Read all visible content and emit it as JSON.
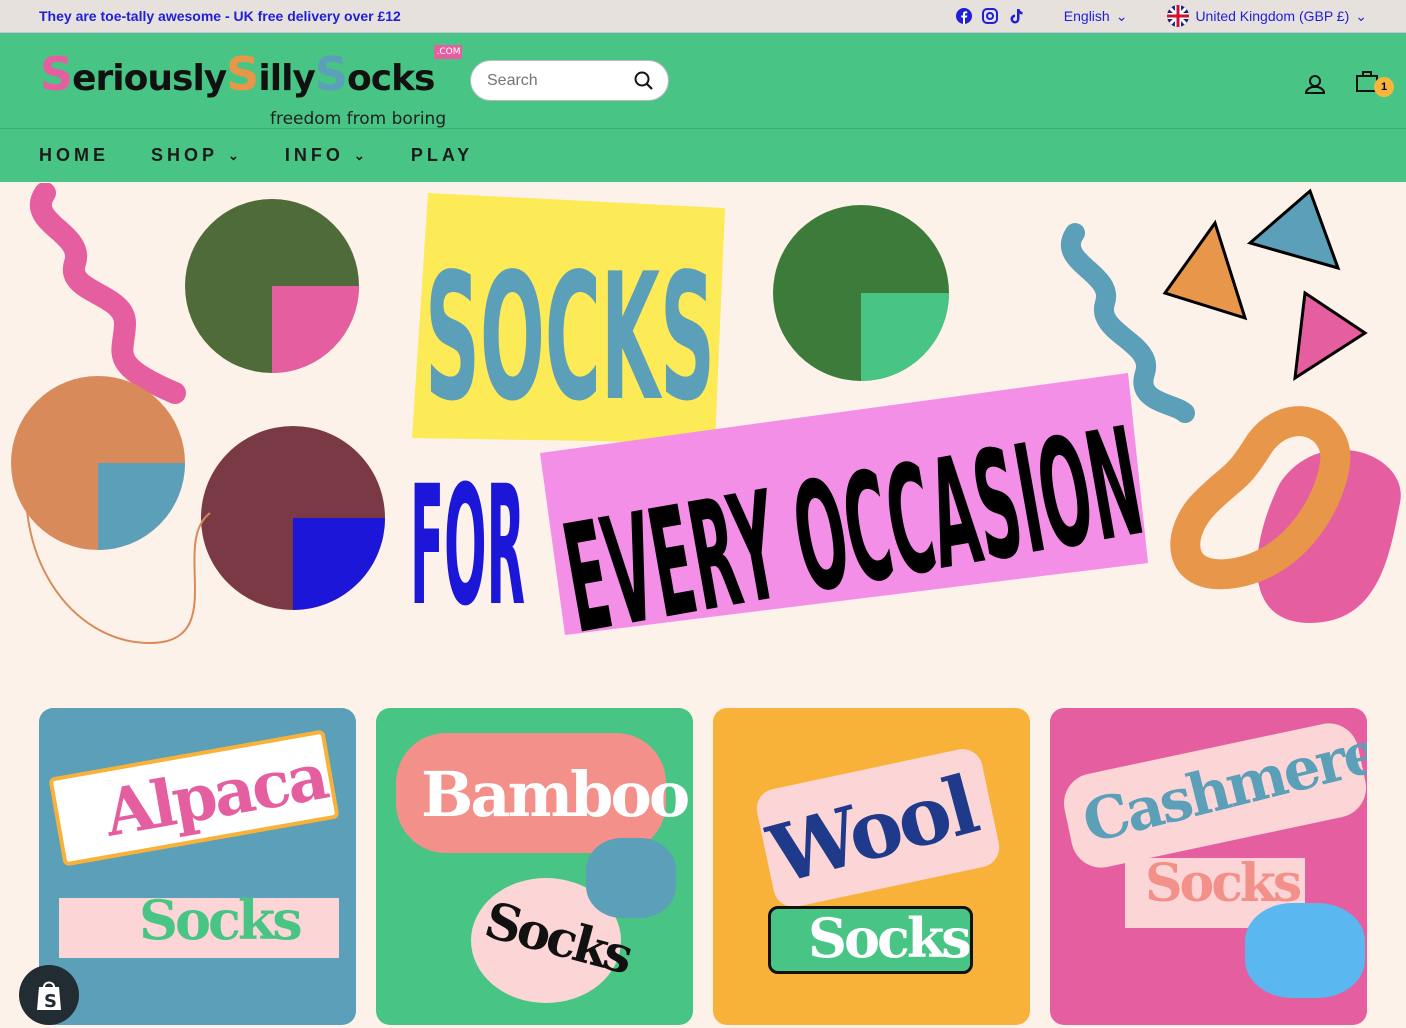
{
  "announcement": "They are toe-tally awesome - UK free delivery over £12",
  "social": [
    "facebook-icon",
    "instagram-icon",
    "tiktok-icon"
  ],
  "language": "English",
  "country": "United Kingdom (GBP £)",
  "logo": {
    "text": "SeriouslySillySocks",
    "suffix": ".COM",
    "tagline": "freedom from boring"
  },
  "search": {
    "placeholder": "Search"
  },
  "cart": {
    "count": "1"
  },
  "nav": [
    {
      "label": "HOME"
    },
    {
      "label": "SHOP"
    },
    {
      "label": "INFO"
    },
    {
      "label": "PLAY"
    }
  ],
  "hero": {
    "line1": "SOCKS",
    "line2": "FOR",
    "line3": "EVERY OCCASION"
  },
  "categories": [
    {
      "name": "Alpaca",
      "sub": "Socks",
      "bg": "#5b9fb8"
    },
    {
      "name": "Bamboo",
      "sub": "Socks",
      "bg": "#48c584"
    },
    {
      "name": "Wool",
      "sub": "Socks",
      "bg": "#f8b23a"
    },
    {
      "name": "Cashmere",
      "sub": "Socks",
      "bg": "#e55fa0"
    }
  ],
  "colors": {
    "green": "#48c584",
    "pink": "#e55fa0",
    "blue": "#5b9fb8",
    "orange": "#f8b23a",
    "navy": "#1f1fd8"
  }
}
